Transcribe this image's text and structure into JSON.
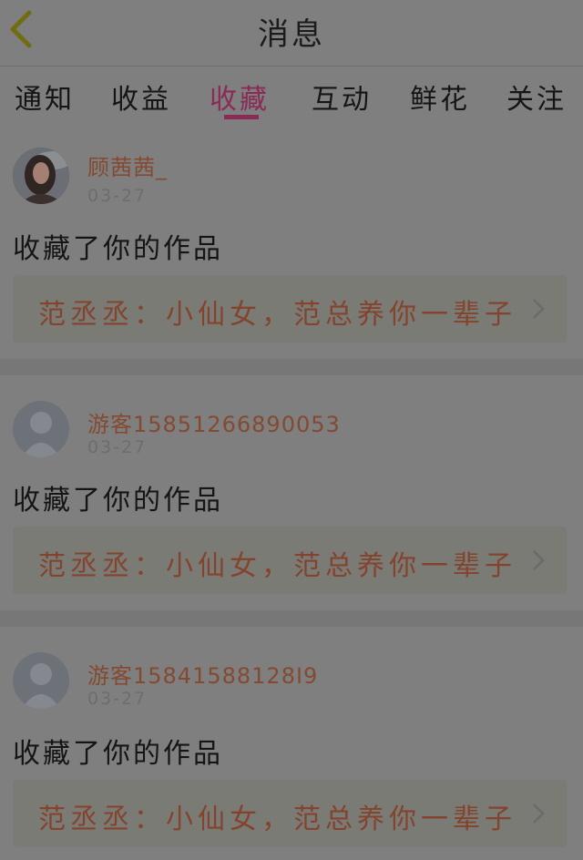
{
  "header": {
    "title": "消息"
  },
  "tabs": [
    {
      "label": "通知"
    },
    {
      "label": "收益"
    },
    {
      "label": "收藏"
    },
    {
      "label": "互动"
    },
    {
      "label": "鲜花"
    },
    {
      "label": "关注"
    }
  ],
  "active_tab": "收藏",
  "items": [
    {
      "name": "顾茜茜_",
      "time": "03-27",
      "action": "收藏了你的作品",
      "work": "范丞丞：小仙女，范总养你一辈子"
    },
    {
      "name": "游客15851266890053",
      "time": "03-27",
      "action": "收藏了你的作品",
      "work": "范丞丞：小仙女，范总养你一辈子"
    },
    {
      "name": "游客15841588128I9",
      "time": "03-27",
      "action": "收藏了你的作品",
      "work": "范丞丞：小仙女，范总养你一辈子"
    }
  ],
  "colors": {
    "accent": "#8a2a57",
    "name": "#844a31",
    "overlay": "#7f7f7f"
  }
}
